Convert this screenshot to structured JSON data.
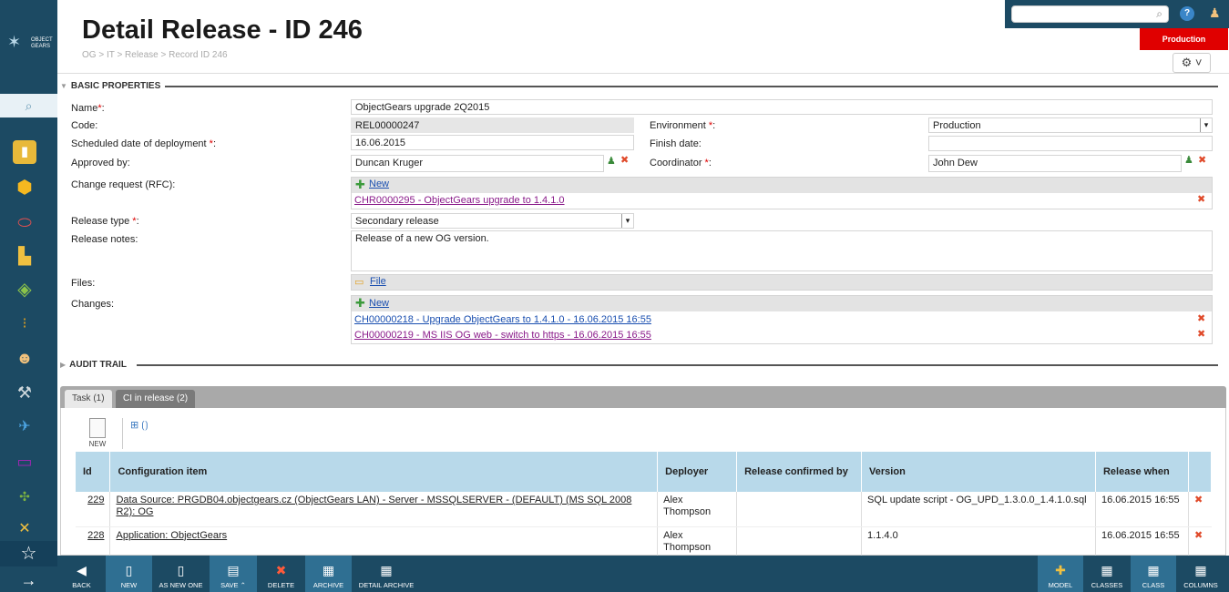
{
  "app": {
    "logo_text": "OBJECT GEARS",
    "environment": "Production"
  },
  "colors": {
    "primary": "#1c4a63",
    "accent": "#2f6f92",
    "environment_badge": "#e00000",
    "grid_header": "#b8d9ea",
    "link": "#1a4fb0",
    "visited_link": "#8a1a8a"
  },
  "sidebar": {
    "icons": [
      "search-icon",
      "folder-icon",
      "badge-icon",
      "tag-icon",
      "boxes-icon",
      "cube-icon",
      "traffic-light-icon",
      "person-icon",
      "tools-icon",
      "satellite-icon",
      "monitor-icon",
      "network-icon",
      "wrench-icon",
      "star-icon",
      "arrow-right-icon"
    ]
  },
  "header": {
    "title": "Detail Release - ID 246",
    "breadcrumb": "OG > IT > Release > Record ID 246",
    "search_placeholder": "",
    "help_symbol": "?",
    "gear_symbol": "⚙ ˅"
  },
  "basic": {
    "section_title": "BASIC PROPERTIES",
    "name_label": "Name",
    "name_value": "ObjectGears upgrade 2Q2015",
    "code_label": "Code:",
    "code_value": "REL00000247",
    "environment_label": "Environment",
    "environment_value": "Production",
    "scheduled_label": "Scheduled date of deployment",
    "scheduled_value": "16.06.2015",
    "finish_label": "Finish date:",
    "finish_value": "",
    "approved_label": "Approved by:",
    "approved_value": "Duncan Kruger",
    "coordinator_label": "Coordinator",
    "coordinator_value": "John Dew",
    "rfc_label": "Change request (RFC):",
    "rfc_new": "New",
    "rfc_items": [
      "CHR0000295 - ObjectGears upgrade to 1.4.1.0"
    ],
    "release_type_label": "Release type",
    "release_type_value": "Secondary release",
    "notes_label": "Release notes:",
    "notes_value": "Release of a new OG version.",
    "files_label": "Files:",
    "files_link": "File",
    "changes_label": "Changes:",
    "changes_new": "New",
    "changes_items": [
      "CH00000218 - Upgrade ObjectGears to 1.4.1.0 - 16.06.2015 16:55",
      "CH00000219 - MS IIS OG web - switch to https - 16.06.2015 16:55"
    ]
  },
  "audit": {
    "section_title": "AUDIT TRAIL"
  },
  "tabs": [
    {
      "label": "Task (1)",
      "active": false
    },
    {
      "label": "CI in release (2)",
      "active": true
    }
  ],
  "grid_toolbar": {
    "new_label": "NEW",
    "expand_symbol": "⊞ ⟮⟯"
  },
  "grid": {
    "columns": [
      "Id",
      "Configuration item",
      "Deployer",
      "Release confirmed by",
      "Version",
      "Release when"
    ],
    "rows": [
      {
        "id": "229",
        "ci": "Data Source: PRGDB04.objectgears.cz (ObjectGears LAN) - Server - MSSQLSERVER - (DEFAULT) (MS SQL 2008 R2): OG",
        "deployer": "Alex Thompson",
        "confirmed": "",
        "version": "SQL update script - OG_UPD_1.3.0.0_1.4.1.0.sql",
        "when": "16.06.2015 16:55"
      },
      {
        "id": "228",
        "ci": "Application: ObjectGears",
        "deployer": "Alex Thompson",
        "confirmed": "",
        "version": "1.1.4.0",
        "when": "16.06.2015 16:55"
      }
    ]
  },
  "bottom_toolbar": {
    "left": [
      "BACK",
      "NEW",
      "AS NEW ONE",
      "SAVE ⌃",
      "DELETE",
      "ARCHIVE",
      "DETAIL ARCHIVE"
    ],
    "right": [
      "MODEL",
      "CLASSES",
      "CLASS",
      "COLUMNS"
    ]
  }
}
